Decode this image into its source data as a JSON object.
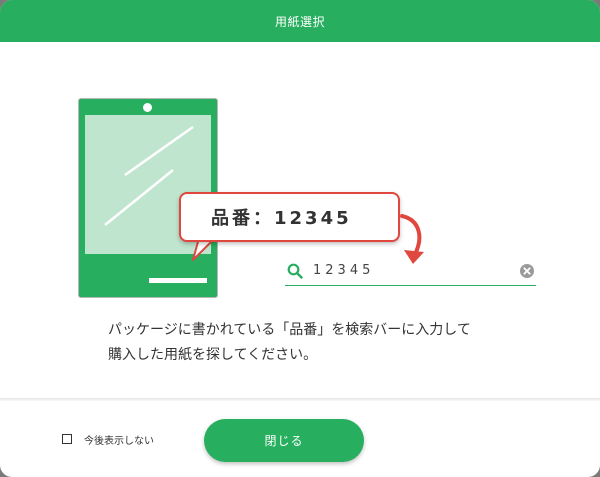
{
  "dialog": {
    "title": "用紙選択"
  },
  "illustration": {
    "callout_text": "品番：12345",
    "search_value": "12345"
  },
  "instructions": {
    "line1": "パッケージに書かれている「品番」を検索バーに入力して",
    "line2": "購入した用紙を探してください。"
  },
  "footer": {
    "checkbox_label": "今後表示しない",
    "checkbox_checked": false,
    "close_label": "閉じる"
  },
  "colors": {
    "primary": "#27ae5f",
    "accent_red": "#e0473f",
    "tablet_screen": "#bfe5cf"
  },
  "icons": {
    "search": "search-icon",
    "clear": "clear-icon",
    "arrow": "curved-arrow-icon",
    "tablet": "tablet-illustration"
  }
}
